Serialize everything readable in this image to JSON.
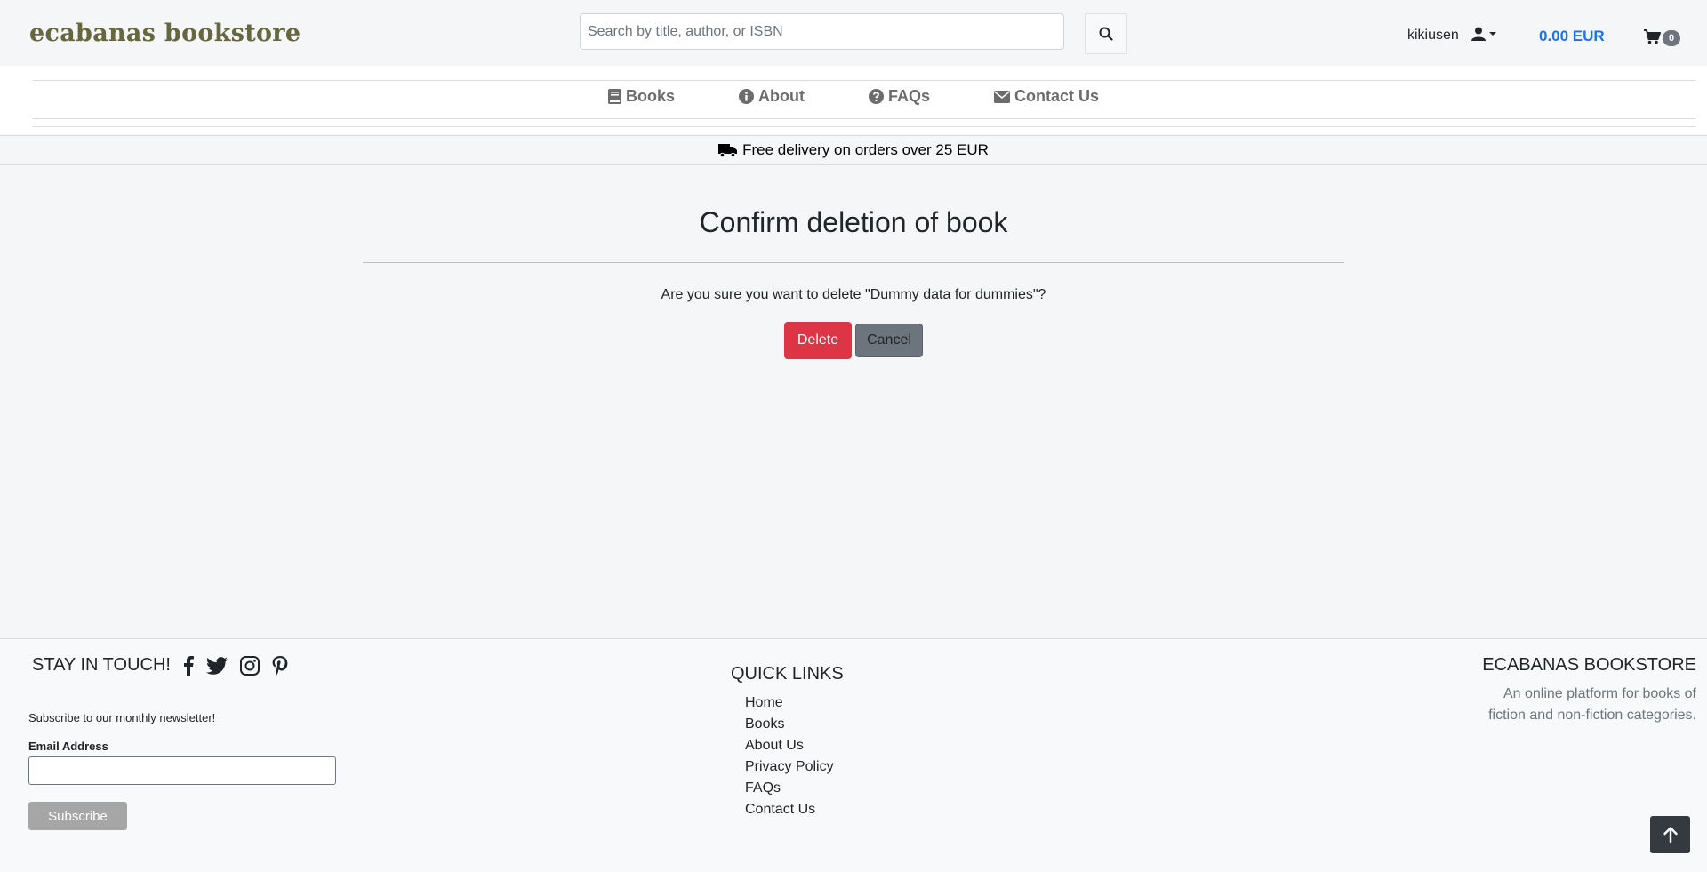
{
  "header": {
    "logo": "ecabanas bookstore",
    "search_placeholder": "Search by title, author, or ISBN",
    "username": "kikiusen",
    "cart_total": "0.00 EUR",
    "cart_count": "0"
  },
  "nav": {
    "items": [
      {
        "label": "Books",
        "icon": "book-icon"
      },
      {
        "label": "About",
        "icon": "info-icon"
      },
      {
        "label": "FAQs",
        "icon": "question-icon"
      },
      {
        "label": "Contact Us",
        "icon": "envelope-icon"
      }
    ]
  },
  "banner": {
    "text": "Free delivery on orders over 25 EUR",
    "icon": "truck-icon"
  },
  "main": {
    "title": "Confirm deletion of book",
    "question": "Are you sure you want to delete \"Dummy data for dummies\"?",
    "delete_label": "Delete",
    "cancel_label": "Cancel"
  },
  "footer": {
    "stay_label": "STAY IN TOUCH!",
    "social_icons": [
      "facebook-icon",
      "twitter-icon",
      "instagram-icon",
      "pinterest-icon"
    ],
    "newsletter_text": "Subscribe to our monthly newsletter!",
    "email_label": "Email Address",
    "subscribe_label": "Subscribe",
    "quick_links_title": "QUICK LINKS",
    "quick_links": [
      "Home",
      "Books",
      "About Us",
      "Privacy Policy",
      "FAQs",
      "Contact Us"
    ],
    "brand_title": "ECABANAS BOOKSTORE",
    "brand_desc": "An online platform for books of fiction and non-fiction categories."
  },
  "colors": {
    "accent": "#1a73e8",
    "danger": "#dc3545",
    "secondary": "#6c757d",
    "logo": "#66663f"
  }
}
